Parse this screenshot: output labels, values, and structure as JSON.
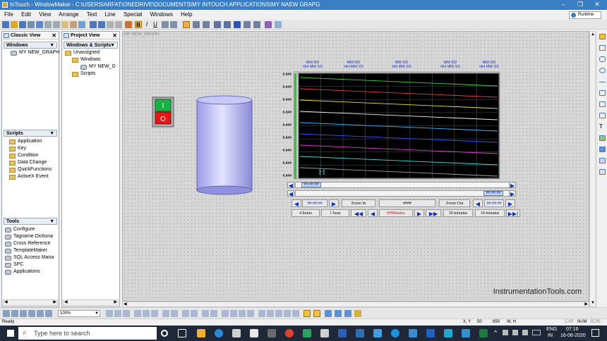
{
  "window": {
    "title": "InTouch - WindowMaker - C:\\USERS\\ARFAT\\ONEDRIVE\\DOCUMENTS\\MY INTOUCH APPLICATIONS\\MY NAEW GRAPG",
    "minimize": "–",
    "maximize": "❐",
    "close": "✕"
  },
  "menu": [
    "File",
    "Edit",
    "View",
    "Arrange",
    "Text",
    "Line",
    "Special",
    "Windows",
    "Help"
  ],
  "runtime_label": "Runtime",
  "toolbar": {
    "bold": "B",
    "italic": "I",
    "underline": "U"
  },
  "classic_view": {
    "title": "Classic View",
    "windows_header": "Windows",
    "window_item": "MY NEW_GRAPH",
    "scripts_header": "Scripts",
    "scripts": [
      "Application",
      "Key",
      "Condition",
      "Data Change",
      "QuickFunctions",
      "ActiveX Event"
    ],
    "tools_header": "Tools",
    "tools": [
      "Configure",
      "Tagname Dictiona",
      "Cross Reference",
      "TemplateMaker",
      "SQL Access Mana",
      "SPC",
      "Applications"
    ]
  },
  "project_view": {
    "title": "Project View",
    "header": "Windows & Scripts",
    "unassigned": "Unassigned",
    "windows": "Windows",
    "window_item": "MY NEW_G",
    "scripts": "Scripts"
  },
  "canvas": {
    "tab_label": "MY NEW_GRAPH",
    "watermark": "InstrumentationTools.com",
    "switch_on": "I",
    "switch_off": "O"
  },
  "trend": {
    "time_labels": [
      {
        "date": "MM DD",
        "time": "HH MM SS"
      },
      {
        "date": "MM DD",
        "time": "HH MM SS"
      },
      {
        "date": "MM DD",
        "time": "HH MM SS"
      },
      {
        "date": "MM DD",
        "time": "HH MM SS"
      },
      {
        "date": "MM DD",
        "time": "HH MM SS"
      }
    ],
    "y_labels": [
      "#.###",
      "#.###",
      "#.###",
      "#.###",
      "#.###",
      "#.###",
      "#.###",
      "#.###",
      "#.###"
    ],
    "cursor_glyph": "H",
    "line_colors": [
      "#40d040",
      "#e04040",
      "#f0e040",
      "#f0f0f0",
      "#40b0ff",
      "#3050ff",
      "#e040d0",
      "#40e0e0",
      "#a0a0a0"
    ],
    "scroll_left_value": "##.##.##",
    "scroll_right_value": "##.##.##",
    "start_time": "##:##:##",
    "zoom_in": "Zoom In",
    "zoom_value": "####",
    "zoom_out": "Zoom Out",
    "end_time": "##:##:##",
    "btn_4hours": "4 hours",
    "btn_1hour": "1 hour",
    "span_value": "##Minutes",
    "btn_30min": "30 minutes",
    "btn_10min": "10 minutes"
  },
  "bottom": {
    "zoom": "100%"
  },
  "status": {
    "left": "Ready",
    "xy_label": "X, Y",
    "x": "50",
    "y": "650",
    "wh_label": "W, H",
    "caps": "CAP",
    "num": "NUM",
    "scrl": "SCRL"
  },
  "taskbar": {
    "search_placeholder": "Type here to search",
    "lang": "ENG",
    "region": "IN",
    "time": "07:16",
    "date": "16-06-2020"
  }
}
